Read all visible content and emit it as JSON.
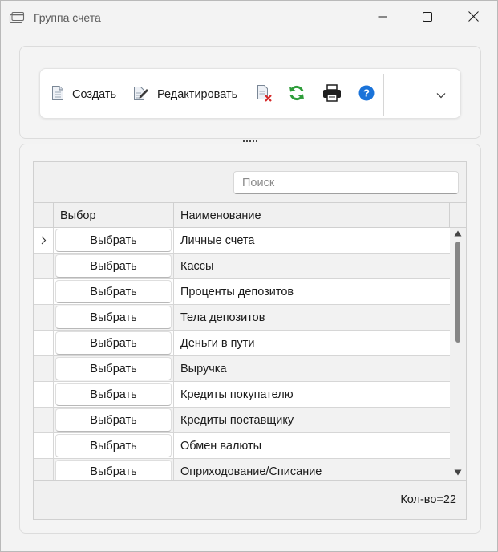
{
  "window": {
    "title": "Группа счета",
    "icons": {
      "app": "card-icon",
      "minimize": "minimize-icon",
      "maximize": "maximize-icon",
      "close": "close-icon"
    }
  },
  "toolbar": {
    "create_label": "Создать",
    "edit_label": "Редактировать",
    "icons": [
      "document-icon",
      "edit-document-icon",
      "delete-document-icon",
      "refresh-icon",
      "print-icon",
      "help-icon",
      "chevron-down-icon"
    ],
    "colors": {
      "refresh": "#2e9d3a",
      "delete": "#d62828",
      "help": "#1a73d9"
    }
  },
  "grid": {
    "search_placeholder": "Поиск",
    "columns": [
      "Выбор",
      "Наименование"
    ],
    "select_label": "Выбрать",
    "rows": [
      {
        "name": "Личные счета",
        "current": true
      },
      {
        "name": "Кассы"
      },
      {
        "name": "Проценты депозитов"
      },
      {
        "name": "Тела депозитов"
      },
      {
        "name": "Деньги в пути"
      },
      {
        "name": "Выручка"
      },
      {
        "name": "Кредиты покупателю"
      },
      {
        "name": "Кредиты поставщику"
      },
      {
        "name": "Обмен валюты"
      },
      {
        "name": "Оприходование/Списание"
      }
    ],
    "count_text": "Кол-во=22"
  }
}
